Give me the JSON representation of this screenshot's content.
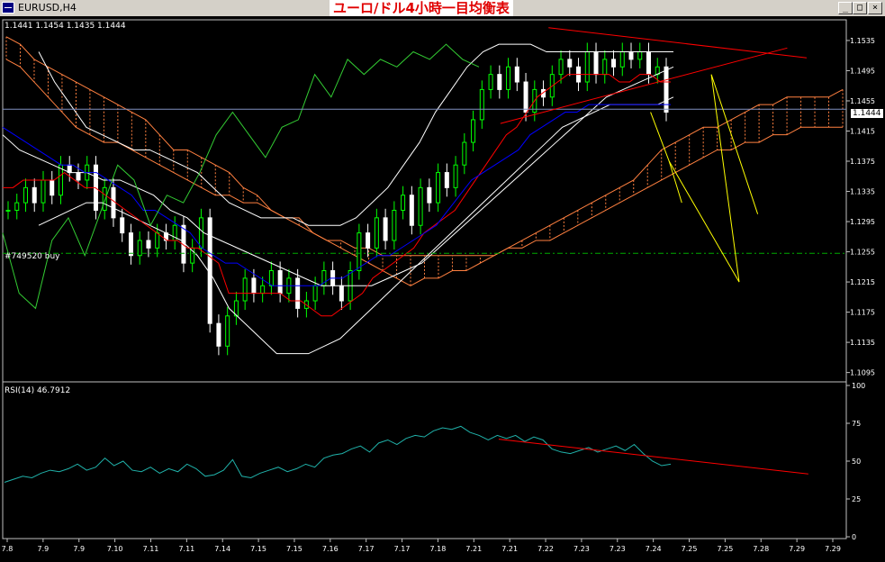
{
  "window": {
    "title": "EURUSD,H4",
    "banner": "ユーロ/ドル4小時一目均衡表"
  },
  "window_buttons": {
    "minimize": "_",
    "maximize": "□",
    "close": "×"
  },
  "ohlc_readout": "1.1441 1.1454 1.1435 1.1444",
  "order_label": "#749520 buy",
  "rsi_label": "RSI(14) 46.7912",
  "current_price": "1.1444",
  "colors": {
    "bull": "#00ff00",
    "bear": "#ffffff",
    "tenkan": "#ff0000",
    "kijun": "#0000ff",
    "chikou": "#33cc33",
    "bollinger": "#ffffff",
    "cloud": "#ff8040",
    "trend": "#ff0000",
    "projection": "#ffff00",
    "rsi": "#20b2aa",
    "order": "#00aa00"
  },
  "chart_data": [
    {
      "type": "candlestick",
      "title": "EURUSD,H4",
      "y_ticks": [
        "1.1535",
        "1.1495",
        "1.1455",
        "1.1415",
        "1.1375",
        "1.1335",
        "1.1295",
        "1.1255",
        "1.1215",
        "1.1175",
        "1.1135",
        "1.1095"
      ],
      "ylim": [
        1.1085,
        1.156
      ],
      "x_ticks": [
        "7.8",
        "7.9",
        "7.9",
        "7.10",
        "7.11",
        "7.11",
        "7.14",
        "7.15",
        "7.15",
        "7.16",
        "7.17",
        "7.17",
        "7.18",
        "7.21",
        "7.21",
        "7.22",
        "7.23",
        "7.23",
        "7.24",
        "7.25",
        "7.25",
        "7.28",
        "7.29",
        "7.29"
      ],
      "order_level": 1.1253,
      "current_price": 1.1444,
      "close": [
        1.131,
        1.132,
        1.134,
        1.132,
        1.135,
        1.133,
        1.137,
        1.136,
        1.135,
        1.137,
        1.131,
        1.134,
        1.13,
        1.128,
        1.125,
        1.127,
        1.126,
        1.128,
        1.127,
        1.129,
        1.124,
        1.126,
        1.13,
        1.116,
        1.113,
        1.117,
        1.119,
        1.122,
        1.12,
        1.121,
        1.123,
        1.12,
        1.122,
        1.118,
        1.119,
        1.121,
        1.123,
        1.121,
        1.119,
        1.123,
        1.128,
        1.126,
        1.13,
        1.127,
        1.131,
        1.133,
        1.129,
        1.134,
        1.132,
        1.136,
        1.134,
        1.137,
        1.14,
        1.143,
        1.147,
        1.149,
        1.147,
        1.15,
        1.148,
        1.144,
        1.147,
        1.146,
        1.149,
        1.151,
        1.15,
        1.148,
        1.152,
        1.149,
        1.151,
        1.15,
        1.152,
        1.151,
        1.152,
        1.149,
        1.15,
        1.144
      ],
      "tenkan": [
        1.134,
        1.134,
        1.135,
        1.135,
        1.135,
        1.135,
        1.136,
        1.135,
        1.134,
        1.134,
        1.133,
        1.132,
        1.131,
        1.13,
        1.129,
        1.128,
        1.127,
        1.127,
        1.126,
        1.126,
        1.125,
        1.124,
        1.12,
        1.12,
        1.12,
        1.12,
        1.12,
        1.12,
        1.119,
        1.119,
        1.118,
        1.117,
        1.117,
        1.118,
        1.119,
        1.12,
        1.122,
        1.123,
        1.124,
        1.125,
        1.126,
        1.128,
        1.129,
        1.13,
        1.131,
        1.133,
        1.135,
        1.137,
        1.139,
        1.141,
        1.142,
        1.144,
        1.146,
        1.147,
        1.148,
        1.149,
        1.149,
        1.149,
        1.149,
        1.149,
        1.148,
        1.148,
        1.149,
        1.149,
        1.148,
        1.148
      ],
      "kijun": [
        1.142,
        1.141,
        1.14,
        1.139,
        1.138,
        1.137,
        1.137,
        1.136,
        1.136,
        1.135,
        1.134,
        1.133,
        1.131,
        1.131,
        1.13,
        1.129,
        1.128,
        1.126,
        1.125,
        1.124,
        1.124,
        1.123,
        1.122,
        1.121,
        1.121,
        1.121,
        1.121,
        1.121,
        1.122,
        1.122,
        1.123,
        1.124,
        1.125,
        1.125,
        1.126,
        1.127,
        1.128,
        1.129,
        1.131,
        1.133,
        1.135,
        1.136,
        1.137,
        1.138,
        1.139,
        1.141,
        1.142,
        1.143,
        1.144,
        1.144,
        1.145,
        1.145,
        1.145,
        1.145,
        1.145,
        1.145,
        1.145,
        1.145
      ],
      "senkou_a": [
        1.154,
        1.153,
        1.151,
        1.15,
        1.149,
        1.148,
        1.147,
        1.146,
        1.145,
        1.144,
        1.143,
        1.141,
        1.139,
        1.139,
        1.138,
        1.137,
        1.136,
        1.134,
        1.133,
        1.131,
        1.13,
        1.129,
        1.128,
        1.127,
        1.126,
        1.125,
        1.124,
        1.123,
        1.122,
        1.121,
        1.122,
        1.122,
        1.123,
        1.123,
        1.124,
        1.125,
        1.126,
        1.127,
        1.128,
        1.129,
        1.13,
        1.131,
        1.132,
        1.133,
        1.134,
        1.135,
        1.137,
        1.139,
        1.14,
        1.141,
        1.142,
        1.142,
        1.143,
        1.144,
        1.145,
        1.145,
        1.146,
        1.146,
        1.146,
        1.146,
        1.147
      ],
      "senkou_b": [
        1.151,
        1.15,
        1.148,
        1.146,
        1.144,
        1.142,
        1.141,
        1.14,
        1.14,
        1.139,
        1.138,
        1.137,
        1.136,
        1.135,
        1.134,
        1.133,
        1.133,
        1.132,
        1.132,
        1.131,
        1.13,
        1.13,
        1.128,
        1.127,
        1.127,
        1.126,
        1.126,
        1.125,
        1.125,
        1.125,
        1.125,
        1.125,
        1.125,
        1.125,
        1.125,
        1.125,
        1.126,
        1.126,
        1.127,
        1.127,
        1.128,
        1.129,
        1.13,
        1.131,
        1.132,
        1.133,
        1.134,
        1.135,
        1.136,
        1.137,
        1.138,
        1.139,
        1.139,
        1.14,
        1.14,
        1.141,
        1.141,
        1.142,
        1.142,
        1.142,
        1.142
      ],
      "chikou": [
        1.128,
        1.12,
        1.118,
        1.127,
        1.13,
        1.125,
        1.131,
        1.137,
        1.135,
        1.129,
        1.133,
        1.132,
        1.136,
        1.141,
        1.144,
        1.141,
        1.138,
        1.142,
        1.143,
        1.149,
        1.146,
        1.151,
        1.149,
        1.151,
        1.15,
        1.152,
        1.151,
        1.153,
        1.151,
        1.15
      ],
      "bb_mid": [
        1.141,
        1.139,
        1.138,
        1.137,
        1.136,
        1.136,
        1.135,
        1.135,
        1.134,
        1.133,
        1.131,
        1.13,
        1.128,
        1.127,
        1.126,
        1.125,
        1.124,
        1.123,
        1.122,
        1.121,
        1.121,
        1.121,
        1.121,
        1.122,
        1.123,
        1.124,
        1.126,
        1.128,
        1.13,
        1.132,
        1.134,
        1.136,
        1.138,
        1.14,
        1.142,
        1.144,
        1.146,
        1.147,
        1.148,
        1.149,
        1.15
      ],
      "bb_up": [
        1.152,
        1.148,
        1.145,
        1.142,
        1.141,
        1.14,
        1.139,
        1.139,
        1.138,
        1.137,
        1.136,
        1.134,
        1.132,
        1.131,
        1.13,
        1.13,
        1.13,
        1.129,
        1.129,
        1.129,
        1.13,
        1.132,
        1.134,
        1.137,
        1.14,
        1.144,
        1.147,
        1.15,
        1.152,
        1.153,
        1.153,
        1.153,
        1.152,
        1.152,
        1.152,
        1.152,
        1.152,
        1.152,
        1.152,
        1.152,
        1.152
      ],
      "bb_dn": [
        1.129,
        1.13,
        1.131,
        1.132,
        1.132,
        1.131,
        1.13,
        1.129,
        1.128,
        1.127,
        1.125,
        1.122,
        1.118,
        1.116,
        1.114,
        1.112,
        1.112,
        1.112,
        1.113,
        1.114,
        1.116,
        1.118,
        1.12,
        1.122,
        1.124,
        1.126,
        1.128,
        1.13,
        1.132,
        1.134,
        1.136,
        1.138,
        1.14,
        1.142,
        1.143,
        1.144,
        1.145,
        1.145,
        1.145,
        1.145,
        1.146
      ],
      "trendlines": [
        {
          "points": [
            [
              0.647,
              1.1552
            ],
            [
              0.953,
              1.1512
            ]
          ]
        },
        {
          "points": [
            [
              0.59,
              1.1425
            ],
            [
              0.93,
              1.1525
            ]
          ]
        }
      ],
      "projection": [
        [
          0.768,
          1.144
        ],
        [
          0.79,
          1.1375
        ],
        [
          0.873,
          1.1215
        ],
        [
          0.84,
          1.149
        ],
        [
          0.895,
          1.1305
        ]
      ]
    },
    {
      "type": "line",
      "title": "RSI(14) 46.7912",
      "y_ticks": [
        "100",
        "75",
        "50",
        "25",
        "0"
      ],
      "ylim": [
        0,
        100
      ],
      "values": [
        36,
        38,
        40,
        39,
        42,
        44,
        43,
        45,
        48,
        44,
        46,
        52,
        47,
        50,
        44,
        43,
        46,
        42,
        45,
        43,
        48,
        45,
        40,
        41,
        44,
        51,
        40,
        39,
        42,
        44,
        46,
        43,
        45,
        48,
        46,
        52,
        54,
        55,
        58,
        60,
        56,
        62,
        64,
        61,
        65,
        67,
        66,
        70,
        72,
        71,
        73,
        69,
        67,
        64,
        67,
        65,
        67,
        63,
        66,
        64,
        58,
        56,
        55,
        57,
        59,
        56,
        58,
        60,
        57,
        61,
        55,
        50,
        47,
        48
      ],
      "trendline": [
        [
          0.588,
          64.5
        ],
        [
          0.955,
          41.5
        ]
      ]
    }
  ]
}
